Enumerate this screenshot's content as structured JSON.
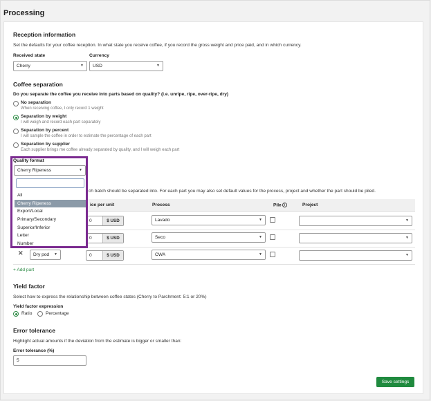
{
  "page": {
    "title": "Processing"
  },
  "reception": {
    "heading": "Reception information",
    "description": "Set the defaults for your coffee reception. In what state you receive coffee, if you record the gross weight and price paid, and in which currency.",
    "received_state_label": "Received state",
    "received_state_value": "Cherry",
    "currency_label": "Currency",
    "currency_value": "USD"
  },
  "separation": {
    "heading": "Coffee separation",
    "question": "Do you separate the coffee you receive into parts based on quality? (i.e. unripe, ripe, over-ripe, dry)",
    "options": [
      {
        "title": "No separation",
        "subtitle": "When receiving coffee, I only record 1 weight",
        "selected": false
      },
      {
        "title": "Separation by weight",
        "subtitle": "I will weigh and record each part separately",
        "selected": true
      },
      {
        "title": "Separation by percent",
        "subtitle": "I will sample the coffee in order to estimate the percentage of each part",
        "selected": false
      },
      {
        "title": "Separation by supplier",
        "subtitle": "Each supplier brings me coffee already separated by quality, and I will weigh each part",
        "selected": false
      }
    ],
    "quality_format_label": "Quality format",
    "quality_format_value": "Cherry Ripeness",
    "quality_format_options": [
      "All",
      "Cherry Ripeness",
      "Export/Local",
      "Primary/Secondary",
      "Superior/Inferior",
      "Letter",
      "Number"
    ],
    "quality_format_selected": "Cherry Ripeness",
    "parts_description_tail": "ch batch should be separated into. For each part you may also set default values for the process, project and whether the part should be piled."
  },
  "parts_table": {
    "headers": {
      "price": "ice per unit",
      "process": "Process",
      "pile": "Pile",
      "project": "Project"
    },
    "rows": [
      {
        "price": "0",
        "currency": "$ USD",
        "process": "Lavado",
        "project": ""
      },
      {
        "price": "0",
        "currency": "$ USD",
        "process": "Seco",
        "project": ""
      },
      {
        "part": "Dry pod",
        "price": "0",
        "currency": "$ USD",
        "process": "CWA",
        "project": ""
      }
    ],
    "add_part": "+ Add part"
  },
  "yield": {
    "heading": "Yield factor",
    "description": "Select how to express the relationship between coffee states (Cherry to Parchment: 5:1 or 20%)",
    "expression_label": "Yield factor expression",
    "ratio_label": "Ratio",
    "percentage_label": "Percentage"
  },
  "tolerance": {
    "heading": "Error tolerance",
    "description": "Highlight actual amounts if the deviation from the estimate is bigger or smaller than:",
    "field_label": "Error tolerance (%)",
    "field_value": "5"
  },
  "actions": {
    "save": "Save settings"
  },
  "colors": {
    "accent": "#1f8a3e",
    "highlight_border": "#7b2b90",
    "selected_option": "#8b9aa8"
  }
}
